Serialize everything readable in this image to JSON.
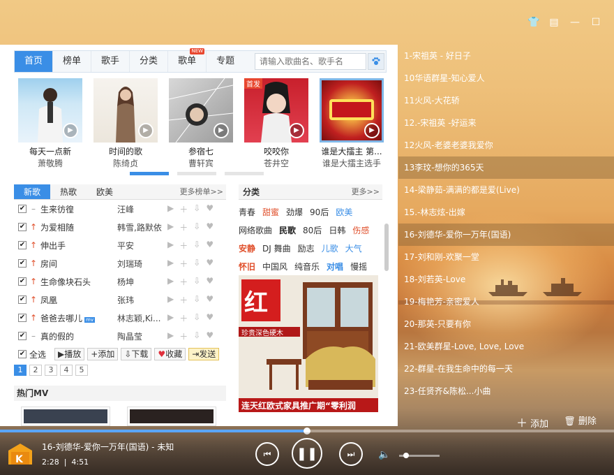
{
  "nav": {
    "tabs": [
      "首页",
      "榜单",
      "歌手",
      "分类",
      "歌单",
      "专题"
    ],
    "new_badge": "NEW",
    "search_placeholder": "请输入歌曲名、歌手名"
  },
  "albums": [
    {
      "title": "每天一点新",
      "subtitle": "萧敬腾"
    },
    {
      "title": "时间的歌",
      "subtitle": "陈绮贞"
    },
    {
      "title": "参宿七",
      "subtitle": "曹轩宾"
    },
    {
      "title": "咬咬你",
      "subtitle": "苍井空",
      "tag": "首发"
    },
    {
      "title": "谁是大擂主 第...",
      "subtitle": "谁是大擂主选手"
    }
  ],
  "newsongs": {
    "tabs": [
      "新歌",
      "热歌",
      "欧美"
    ],
    "more": "更多榜单>>",
    "rows": [
      {
        "name": "生来彷徨",
        "singer": "汪峰",
        "trend": "–"
      },
      {
        "name": "为爱相随",
        "singer": "韩雪,路默依",
        "trend": "↑"
      },
      {
        "name": "伸出手",
        "singer": "平安",
        "trend": "↑"
      },
      {
        "name": "房间",
        "singer": "刘瑞琦",
        "trend": "↑"
      },
      {
        "name": "生命像块石头",
        "singer": "杨坤",
        "trend": "↑"
      },
      {
        "name": "凤凰",
        "singer": "张玮",
        "trend": "↑"
      },
      {
        "name": "爸爸去哪儿",
        "singer": "林志颖,Ki...",
        "trend": "↑",
        "mv": "mv"
      },
      {
        "name": "真的假的",
        "singer": "陶晶莹",
        "trend": "–"
      }
    ],
    "select_all": "全选",
    "play": "播放",
    "add": "添加",
    "download": "下载",
    "fav": "收藏",
    "send": "发送",
    "pages": [
      "1",
      "2",
      "3",
      "4",
      "5"
    ]
  },
  "hotmv": "热门MV",
  "category": {
    "title": "分类",
    "more": "更多>>",
    "rows": [
      [
        {
          "t": "青春",
          "c": "#333"
        },
        {
          "t": "甜蜜",
          "c": "#e0502c"
        },
        {
          "t": "劲爆",
          "c": "#333"
        },
        {
          "t": "90后",
          "c": "#333"
        },
        {
          "t": "欧美",
          "c": "#3a8ee6"
        }
      ],
      [
        {
          "t": "网络歌曲",
          "c": "#333"
        },
        {
          "t": "民歌",
          "c": "#222",
          "b": true
        },
        {
          "t": "80后",
          "c": "#333"
        },
        {
          "t": "日韩",
          "c": "#333"
        },
        {
          "t": "伤感",
          "c": "#e0502c"
        }
      ],
      [
        {
          "t": "安静",
          "c": "#e0502c",
          "b": true
        },
        {
          "t": "DJ 舞曲",
          "c": "#333"
        },
        {
          "t": "励志",
          "c": "#333"
        },
        {
          "t": "儿歌",
          "c": "#3a8ee6"
        },
        {
          "t": "大气",
          "c": "#3a8ee6"
        }
      ],
      [
        {
          "t": "怀旧",
          "c": "#e0502c",
          "b": true
        },
        {
          "t": "中国风",
          "c": "#333"
        },
        {
          "t": "纯音乐",
          "c": "#333"
        },
        {
          "t": "对唱",
          "c": "#3a8ee6",
          "b": true
        },
        {
          "t": "慢摇",
          "c": "#333"
        }
      ]
    ]
  },
  "ad": {
    "title": "连天红欧式家具推广期“零利润",
    "seal": "红",
    "sub": "珍贵深色硬木"
  },
  "playlist": [
    "1-宋祖英 - 好日子",
    "10华语群星-知心爱人",
    "11火风-大花轿",
    "12.-宋祖英 -好运来",
    "12火风-老婆老婆我爱你",
    "13李玟-想你的365天",
    "14-梁静茹-满满的都是爱(Live)",
    "15.-林志炫-出嫁",
    "16-刘德华-爱你一万年(国语)",
    "17-刘和刚-欢聚一堂",
    "18-刘若英-Love",
    "19-梅艳芳-亲密爱人",
    "20-那英-只要有你",
    "21-欧美群星-Love, Love, Love",
    "22-群星-在我生命中的每一天",
    "23-任贤齐&陈松...小曲"
  ],
  "playlist_highlight": [
    5,
    8
  ],
  "playlist_actions": {
    "add": "添加",
    "delete": "删除"
  },
  "player": {
    "now_playing": "16-刘德华-爱你一万年(国语) - 未知",
    "elapsed": "2:28",
    "total": "4:51",
    "progress": 0.5,
    "volume": 0.1
  },
  "colors": {
    "accent": "#3a8ee6",
    "hot": "#e0502c"
  }
}
